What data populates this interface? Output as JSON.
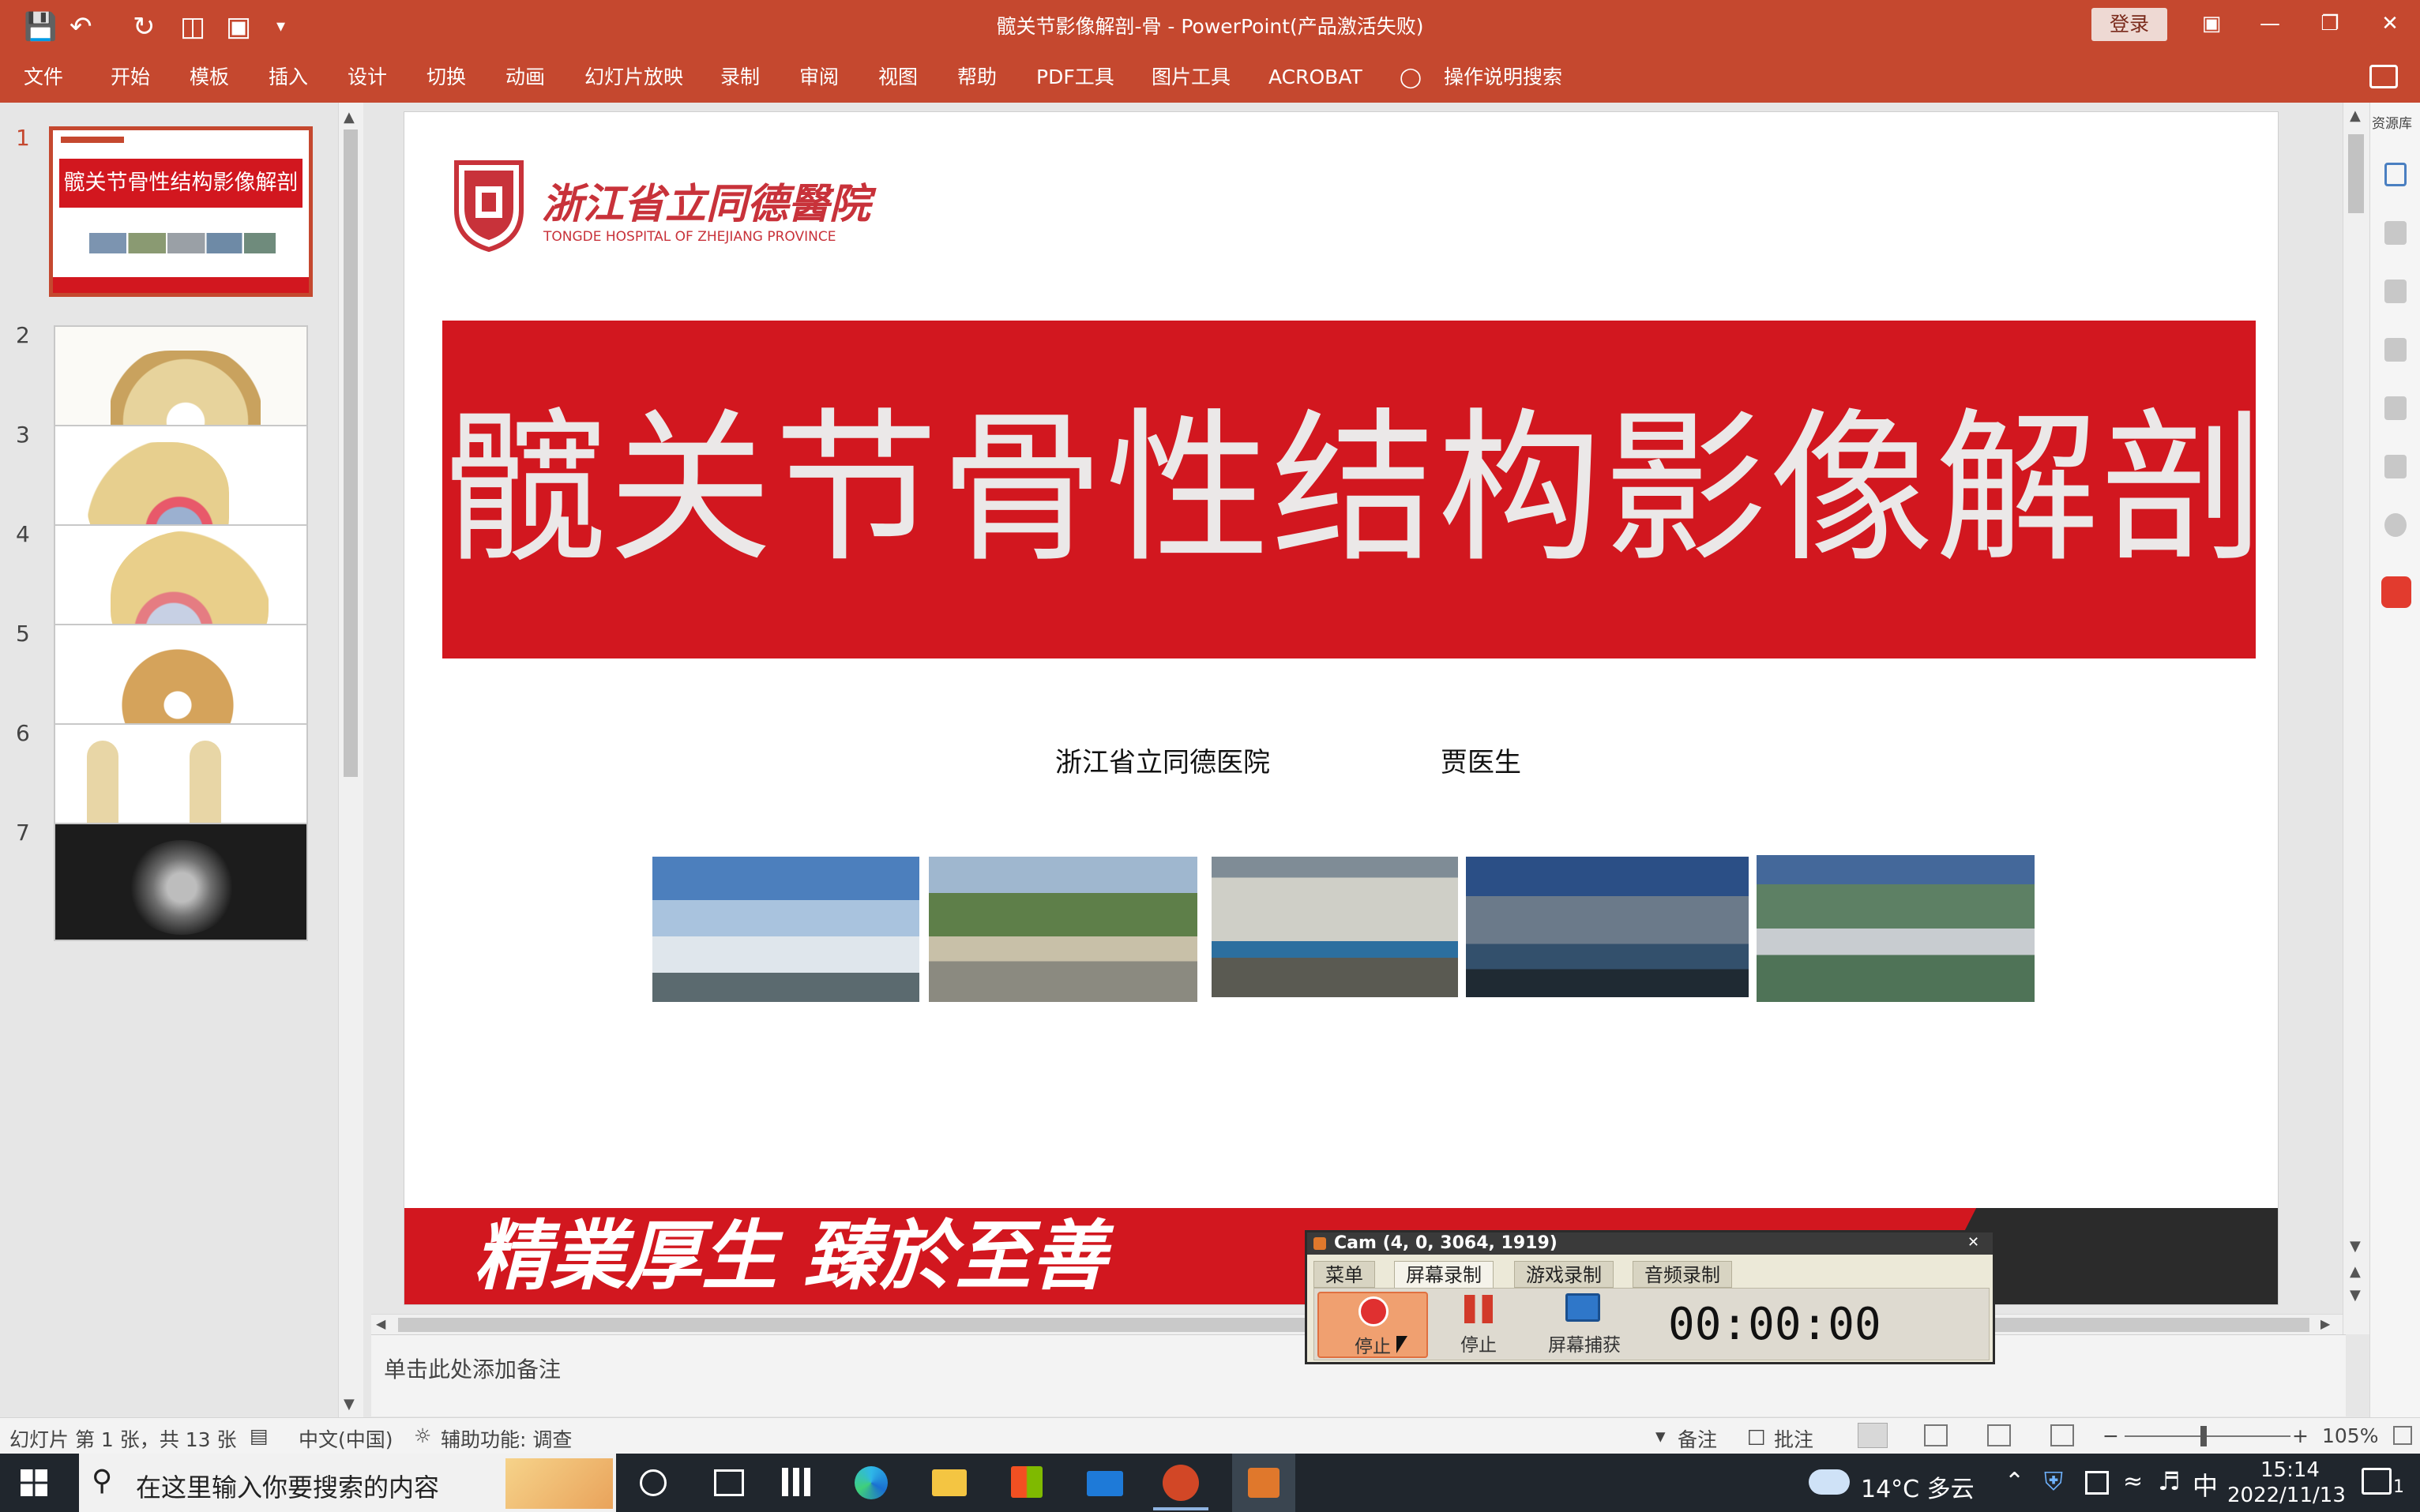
{
  "titlebar": {
    "title": "髋关节影像解剖-骨  -  PowerPoint(产品激活失败)",
    "login": "登录",
    "quick_access": [
      "save-icon",
      "undo-icon",
      "redo-icon",
      "present-icon",
      "layout-icon",
      "customize-icon"
    ]
  },
  "ribbon": {
    "tabs": [
      "文件",
      "开始",
      "模板",
      "插入",
      "设计",
      "切换",
      "动画",
      "幻灯片放映",
      "录制",
      "审阅",
      "视图",
      "帮助",
      "PDF工具",
      "图片工具",
      "ACROBAT"
    ],
    "search": "操作说明搜索"
  },
  "thumbnails": [
    {
      "num": "1",
      "title": "髋关节骨性结构影像解剖"
    },
    {
      "num": "2"
    },
    {
      "num": "3"
    },
    {
      "num": "4"
    },
    {
      "num": "5"
    },
    {
      "num": "6"
    },
    {
      "num": "7"
    }
  ],
  "slide": {
    "hospital_cn": "浙江省立同德醫院",
    "hospital_en": "TONGDE HOSPITAL OF ZHEJIANG PROVINCE",
    "title": "髋关节骨性结构影像解剖",
    "institution": "浙江省立同德医院",
    "author": "贾医生",
    "slogan": "精業厚生  臻於至善"
  },
  "side_panel": {
    "label": "资源库"
  },
  "notes": {
    "placeholder": "单击此处添加备注"
  },
  "statusbar": {
    "slide_info": "幻灯片 第 1 张，共 13 张",
    "language": "中文(中国)",
    "accessibility": "辅助功能: 调查",
    "notes_btn": "备注",
    "comments_btn": "批注",
    "zoom": "105%"
  },
  "recorder": {
    "title": "Cam (4, 0, 3064, 1919)",
    "tabs": [
      "菜单",
      "屏幕录制",
      "游戏录制",
      "音频录制"
    ],
    "stop_label": "停止",
    "pause_label": "停止",
    "capture_label": "屏幕捕获",
    "timer": "00:00:00"
  },
  "taskbar": {
    "search_placeholder": "在这里输入你要搜索的内容",
    "weather": "14°C 多云",
    "ime": "中",
    "time": "15:14",
    "date": "2022/11/13",
    "notif_count": "1"
  },
  "colors": {
    "accent": "#c5482f",
    "slide_red": "#d2171f"
  }
}
